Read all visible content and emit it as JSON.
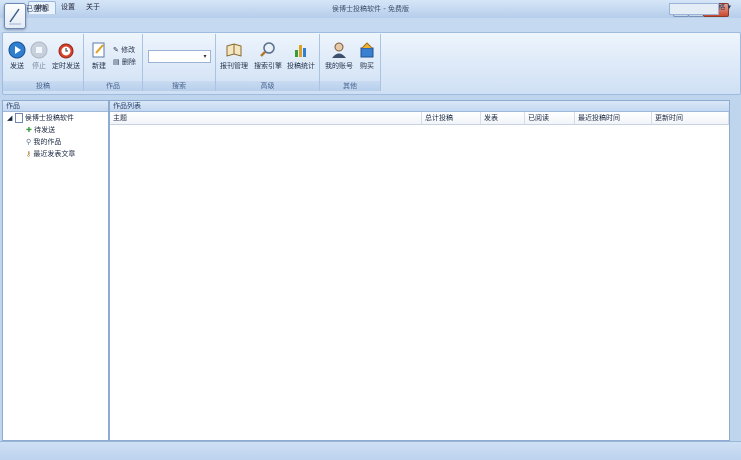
{
  "window": {
    "title": "侯博士投稿软件 - 免费版",
    "min": "–",
    "max": "□",
    "close": "X"
  },
  "tabs": [
    {
      "label": "常规"
    },
    {
      "label": "设置"
    },
    {
      "label": "关于"
    }
  ],
  "theme_link": "界面风格 ▾",
  "ribbon": {
    "groups": [
      {
        "label": "投稿",
        "buttons": [
          {
            "label": "发送",
            "icon": "play-icon"
          },
          {
            "label": "停止",
            "icon": "stop-icon"
          },
          {
            "label": "定时发送",
            "icon": "alarm-clock-icon"
          }
        ]
      },
      {
        "label": "作品",
        "buttons": [
          {
            "label": "新建",
            "icon": "new-document-icon"
          }
        ],
        "small_buttons": [
          {
            "label": "修改",
            "icon": "edit-icon"
          },
          {
            "label": "删除",
            "icon": "delete-icon"
          }
        ]
      },
      {
        "label": "搜索"
      },
      {
        "label": "高级",
        "buttons": [
          {
            "label": "报刊管理",
            "icon": "book-icon"
          },
          {
            "label": "搜索引擎",
            "icon": "magnifier-icon"
          },
          {
            "label": "投稿统计",
            "icon": "bar-chart-icon"
          }
        ]
      },
      {
        "label": "其他",
        "buttons": [
          {
            "label": "我的账号",
            "icon": "user-icon"
          },
          {
            "label": "购买",
            "icon": "purchase-icon"
          }
        ]
      }
    ],
    "search": {
      "value": ""
    }
  },
  "left_panel": {
    "header": "作品",
    "tree_root": "侯博士投稿软件",
    "tree_children": [
      {
        "label": "待发送",
        "icon": "pending-icon"
      },
      {
        "label": "我的作品",
        "icon": "works-icon"
      },
      {
        "label": "最近发表文章",
        "icon": "recent-icon"
      }
    ]
  },
  "right_panel": {
    "header": "作品列表",
    "columns": [
      "主题",
      "总计投稿",
      "发表",
      "已阅读",
      "最近投稿时间",
      "更新时间"
    ]
  },
  "status": {
    "text": "状态：已登陆"
  },
  "colors": {
    "accent": "#c5d9f1",
    "panel_border": "#8eabd2",
    "close_red": "#c84a32"
  }
}
